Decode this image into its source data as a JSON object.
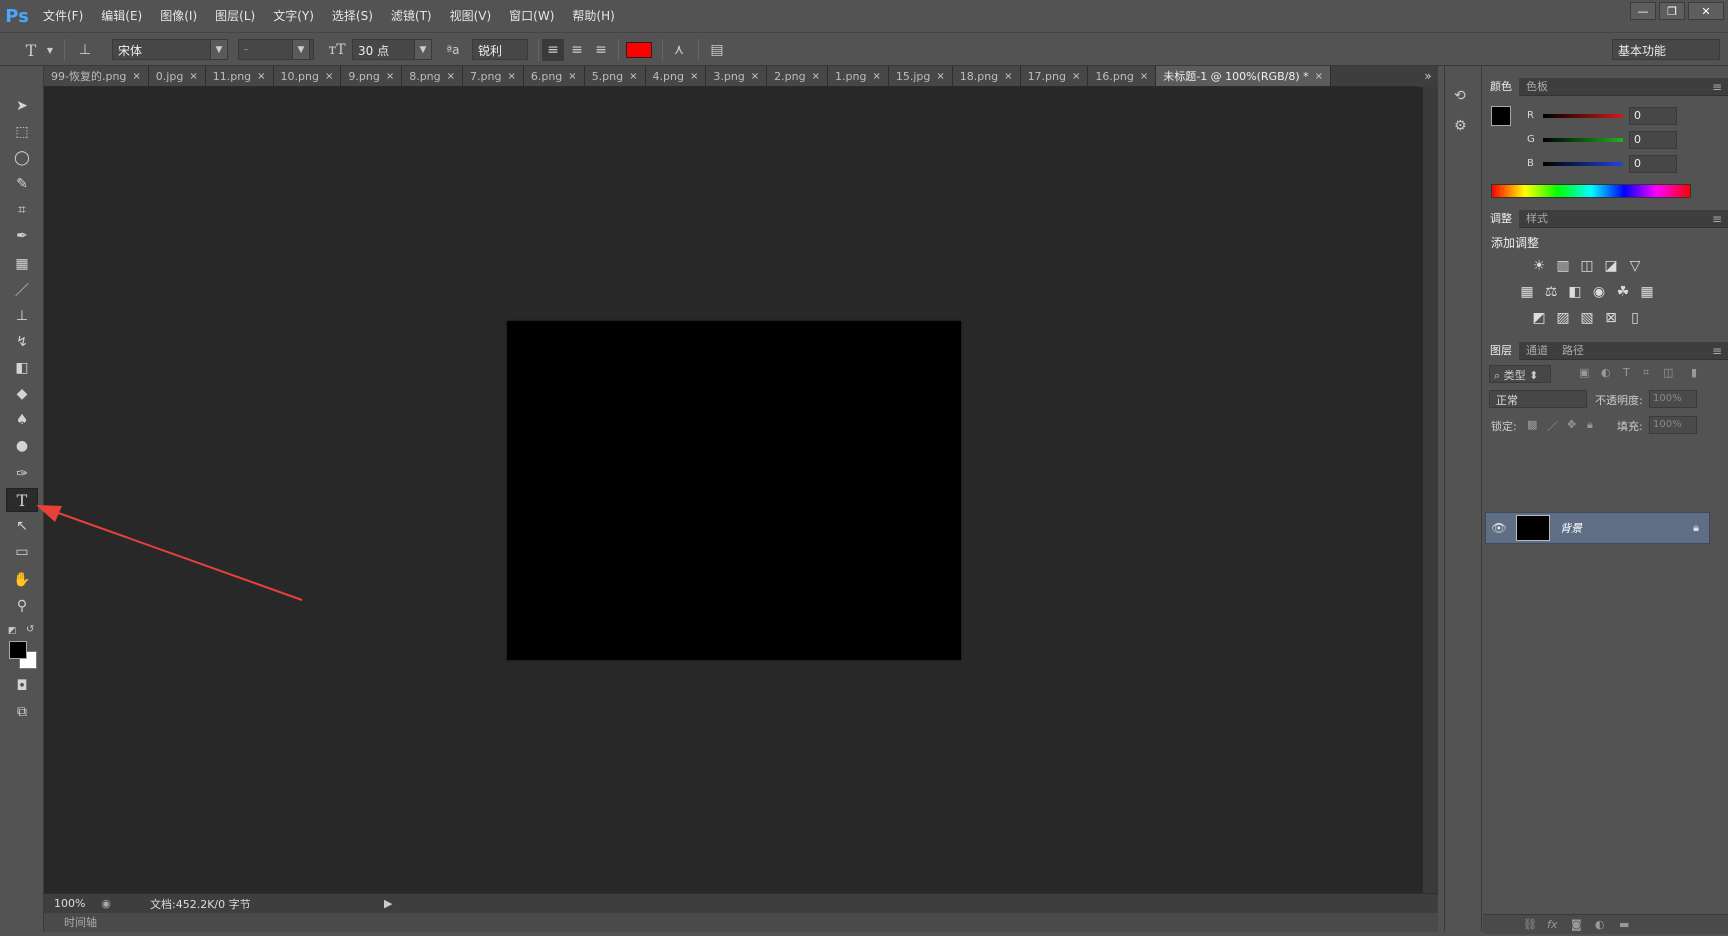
{
  "app": {
    "logo": "Ps"
  },
  "menu": [
    "文件(F)",
    "编辑(E)",
    "图像(I)",
    "图层(L)",
    "文字(Y)",
    "选择(S)",
    "滤镜(T)",
    "视图(V)",
    "窗口(W)",
    "帮助(H)"
  ],
  "window_controls": {
    "minimize": "—",
    "restore": "❐",
    "close": "✕"
  },
  "options": {
    "tool_glyph": "T",
    "font_family": "宋体",
    "font_style": "-",
    "font_size": "30 点",
    "aa_label": "ªa",
    "antialias": "锐利",
    "text_color": "#ff0000",
    "workspace": "基本功能"
  },
  "tabs": [
    {
      "label": "99-恢复的.png",
      "active": false
    },
    {
      "label": "0.jpg",
      "active": false
    },
    {
      "label": "11.png",
      "active": false
    },
    {
      "label": "10.png",
      "active": false
    },
    {
      "label": "9.png",
      "active": false
    },
    {
      "label": "8.png",
      "active": false
    },
    {
      "label": "7.png",
      "active": false
    },
    {
      "label": "6.png",
      "active": false
    },
    {
      "label": "5.png",
      "active": false
    },
    {
      "label": "4.png",
      "active": false
    },
    {
      "label": "3.png",
      "active": false
    },
    {
      "label": "2.png",
      "active": false
    },
    {
      "label": "1.png",
      "active": false
    },
    {
      "label": "15.jpg",
      "active": false
    },
    {
      "label": "18.png",
      "active": false
    },
    {
      "label": "17.png",
      "active": false
    },
    {
      "label": "16.png",
      "active": false
    },
    {
      "label": "未标题-1 @ 100%(RGB/8) *",
      "active": true
    }
  ],
  "tabs_overflow": "»",
  "status": {
    "zoom": "100%",
    "doc": "文档:452.2K/0 字节"
  },
  "timeline": "时间轴",
  "color_panel": {
    "tabs": [
      "颜色",
      "色板"
    ],
    "channels": [
      {
        "label": "R",
        "value": "0",
        "color": "#d21a1a"
      },
      {
        "label": "G",
        "value": "0",
        "color": "#22b022"
      },
      {
        "label": "B",
        "value": "0",
        "color": "#2244dd"
      }
    ]
  },
  "adjust_panel": {
    "tabs": [
      "调整",
      "样式"
    ],
    "title": "添加调整"
  },
  "layers_panel": {
    "tabs": [
      "图层",
      "通道",
      "路径"
    ],
    "filter_kind": "类型",
    "blend_mode": "正常",
    "opacity_label": "不透明度:",
    "opacity_value": "100%",
    "lock_label": "锁定:",
    "fill_label": "填充:",
    "fill_value": "100%",
    "layers": [
      {
        "name": "背景",
        "visible": true,
        "locked": true
      }
    ]
  },
  "colors": {
    "foreground": "#000000",
    "background": "#ffffff",
    "annotation_arrow": "#e8413a"
  }
}
